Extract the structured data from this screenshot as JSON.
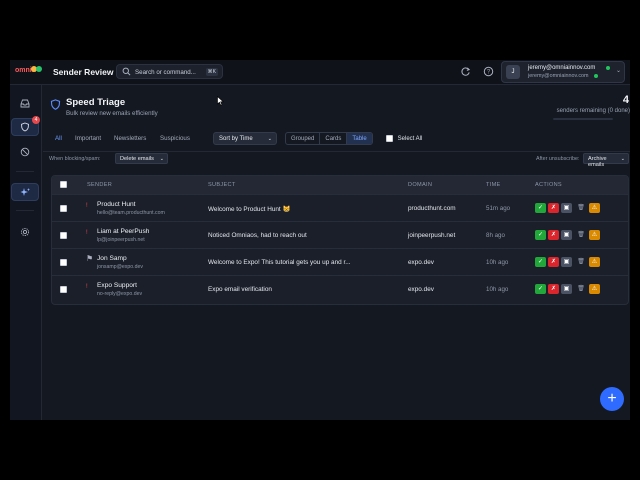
{
  "app": {
    "logo_text": "omnia",
    "title": "Sender Review",
    "search_placeholder": "Search or command...",
    "search_shortcut": "⌘K"
  },
  "account": {
    "avatar_letter": "J",
    "email_primary": "jeremy@omniainnov.com",
    "email_secondary": "jeremy@omniainnov.com"
  },
  "rail": {
    "badge_count": "4",
    "icons": [
      "inbox-icon",
      "shield-icon",
      "block-icon",
      "sparkle-icon",
      "settings-icon"
    ]
  },
  "page": {
    "title": "Speed Triage",
    "subtitle": "Bulk review new emails efficiently",
    "remaining_count": "4",
    "remaining_label": "senders remaining (0 done)",
    "progress": 0
  },
  "filters": {
    "tabs": [
      "All",
      "Important",
      "Newsletters",
      "Suspicious"
    ],
    "active_tab": "All",
    "sort_label": "Sort by Time",
    "views": [
      "Grouped",
      "Cards",
      "Table"
    ],
    "active_view": "Table",
    "select_all_label": "Select All"
  },
  "options": {
    "blocking_label": "When blocking/spam:",
    "blocking_value": "Delete emails",
    "unsubscribe_label": "After unsubscribe:",
    "unsubscribe_value": "Archive emails"
  },
  "table": {
    "headers": [
      "SENDER",
      "SUBJECT",
      "DOMAIN",
      "TIME",
      "ACTIONS"
    ],
    "rows": [
      {
        "name": "Product Hunt",
        "email": "hello@team.producthunt.com",
        "subject": "Welcome to Product Hunt 😸",
        "domain": "producthunt.com",
        "time": "51m ago",
        "icon": "alert-icon"
      },
      {
        "name": "Liam at PeerPush",
        "email": "lp@joinpeerpush.net",
        "subject": "Noticed Omniaos, had to reach out",
        "domain": "joinpeerpush.net",
        "time": "8h ago",
        "icon": "alert-icon"
      },
      {
        "name": "Jon Samp",
        "email": "jonsamp@expo.dev",
        "subject": "Welcome to Expo! This tutorial gets you up and r...",
        "domain": "expo.dev",
        "time": "10h ago",
        "icon": "flag-icon"
      },
      {
        "name": "Expo Support",
        "email": "no-reply@expo.dev",
        "subject": "Expo email verification",
        "domain": "expo.dev",
        "time": "10h ago",
        "icon": "alert-icon"
      }
    ],
    "actions": [
      {
        "name": "keep",
        "symbol": "✓",
        "color": "#22a83a"
      },
      {
        "name": "block",
        "symbol": "✗",
        "color": "#d9252b"
      },
      {
        "name": "archive",
        "symbol": "▣",
        "color": "#4a5264"
      },
      {
        "name": "delete",
        "symbol": "🗑",
        "color": "transparent"
      },
      {
        "name": "spam",
        "symbol": "⚠",
        "color": "#d98a00"
      }
    ]
  },
  "fab_label": "+",
  "colors": {
    "accent": "#2f6bff",
    "background": "#141820",
    "topbar": "#0f1218"
  }
}
